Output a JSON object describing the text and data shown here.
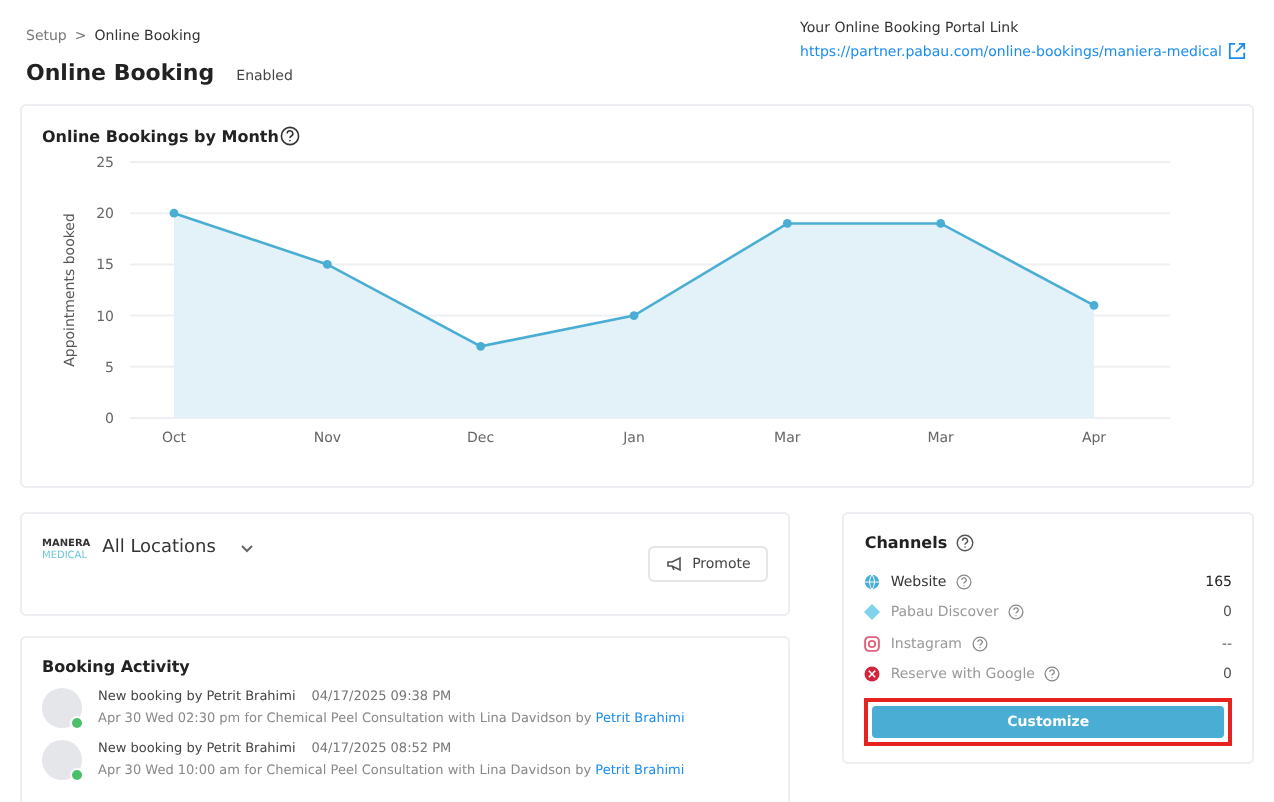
{
  "breadcrumb": [
    {
      "label": "Setup",
      "current": false
    },
    {
      "label": "Online Booking",
      "current": true
    }
  ],
  "breadcrumb_separator": ">",
  "page_title": "Online Booking",
  "status": "Enabled",
  "portal": {
    "label": "Your Online Booking Portal Link",
    "url": "https://partner.pabau.com/online-bookings/maniera-medical"
  },
  "chart_card": {
    "title": "Online Bookings by Month",
    "chart_data": {
      "type": "area",
      "ylabel": "Appointments booked",
      "categories": [
        "Oct",
        "Nov",
        "Dec",
        "Jan",
        "Mar",
        "Mar",
        "Apr"
      ],
      "series": [
        {
          "color": "#4aaed4",
          "values": [
            20,
            15,
            7,
            10,
            19,
            19,
            11
          ]
        }
      ],
      "ylim": [
        0,
        25
      ],
      "yticks": [
        0,
        5,
        10,
        15,
        20,
        25
      ],
      "grid": true
    }
  },
  "location": {
    "logo_top": "MANERA",
    "logo_bottom": "MEDICAL",
    "label": "All Locations",
    "button": "Promote"
  },
  "activity": {
    "title": "Booking Activity",
    "items": [
      {
        "title": "New booking by Petrit Brahimi",
        "time": "04/17/2025 09:38 PM",
        "detail": "Apr 30 Wed 02:30 pm for Chemical Peel Consultation with Lina Davidson by",
        "link": "Petrit Brahimi"
      },
      {
        "title": "New booking by Petrit Brahimi",
        "time": "04/17/2025 08:52 PM",
        "detail": "Apr 30 Wed 10:00 am for Chemical Peel Consultation with Lina Davidson by",
        "link": "Petrit Brahimi"
      }
    ]
  },
  "channels": {
    "title": "Channels",
    "items": [
      {
        "kind": "globe",
        "name": "Website",
        "value": "165",
        "enabled": true
      },
      {
        "kind": "diamond",
        "name": "Pabau Discover",
        "value": "0",
        "enabled": false
      },
      {
        "kind": "instagram",
        "name": "Instagram",
        "value": "--",
        "enabled": false
      },
      {
        "kind": "google",
        "name": "Reserve with Google",
        "value": "0",
        "enabled": false
      }
    ],
    "button": {
      "label": "Customize",
      "highlighted": true
    }
  }
}
